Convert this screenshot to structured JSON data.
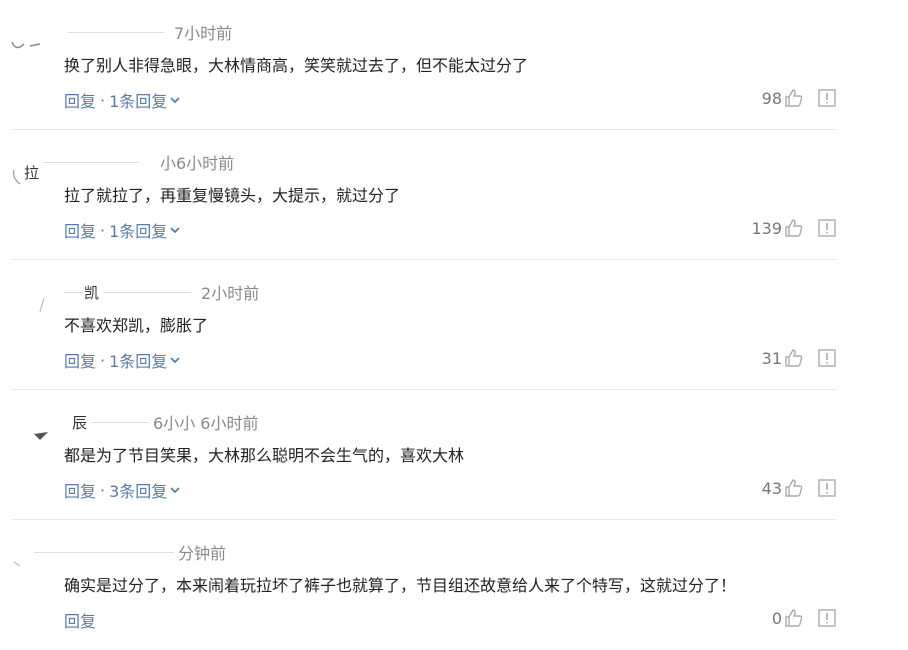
{
  "comments": [
    {
      "username": "",
      "time": "7小时前",
      "text": "换了别人非得急眼，大林情商高，笑笑就过去了，但不能太过分了",
      "reply_label": "回复",
      "sep": "·",
      "replies_label": "1条回复",
      "likes": "98"
    },
    {
      "username": "拉",
      "time": "小6小时前",
      "text": "拉了就拉了，再重复慢镜头，大提示，就过分了",
      "reply_label": "回复",
      "sep": "·",
      "replies_label": "1条回复",
      "likes": "139"
    },
    {
      "username": "凯",
      "time": "2小时前",
      "text": "不喜欢郑凯，膨胀了",
      "reply_label": "回复",
      "sep": "·",
      "replies_label": "1条回复",
      "likes": "31"
    },
    {
      "username": "辰",
      "time": "6小小 6小时前",
      "text": "都是为了节目笑果，大林那么聪明不会生气的，喜欢大林",
      "reply_label": "回复",
      "sep": "·",
      "replies_label": "3条回复",
      "likes": "43"
    },
    {
      "username": "",
      "time": "分钟前",
      "text": "确实是过分了，本来闹着玩拉坏了裤子也就算了，节目组还故意给人来了个特写，这就过分了！",
      "reply_label": "回复",
      "sep": "",
      "replies_label": "",
      "likes": "0"
    }
  ],
  "icons": {
    "like": "thumbs-up-icon",
    "report": "report-icon",
    "expand": "chevron-down-icon"
  },
  "colors": {
    "link": "#5a7ba8",
    "text": "#222222",
    "muted": "#8a8a8a",
    "divider": "#e8e8e8"
  }
}
